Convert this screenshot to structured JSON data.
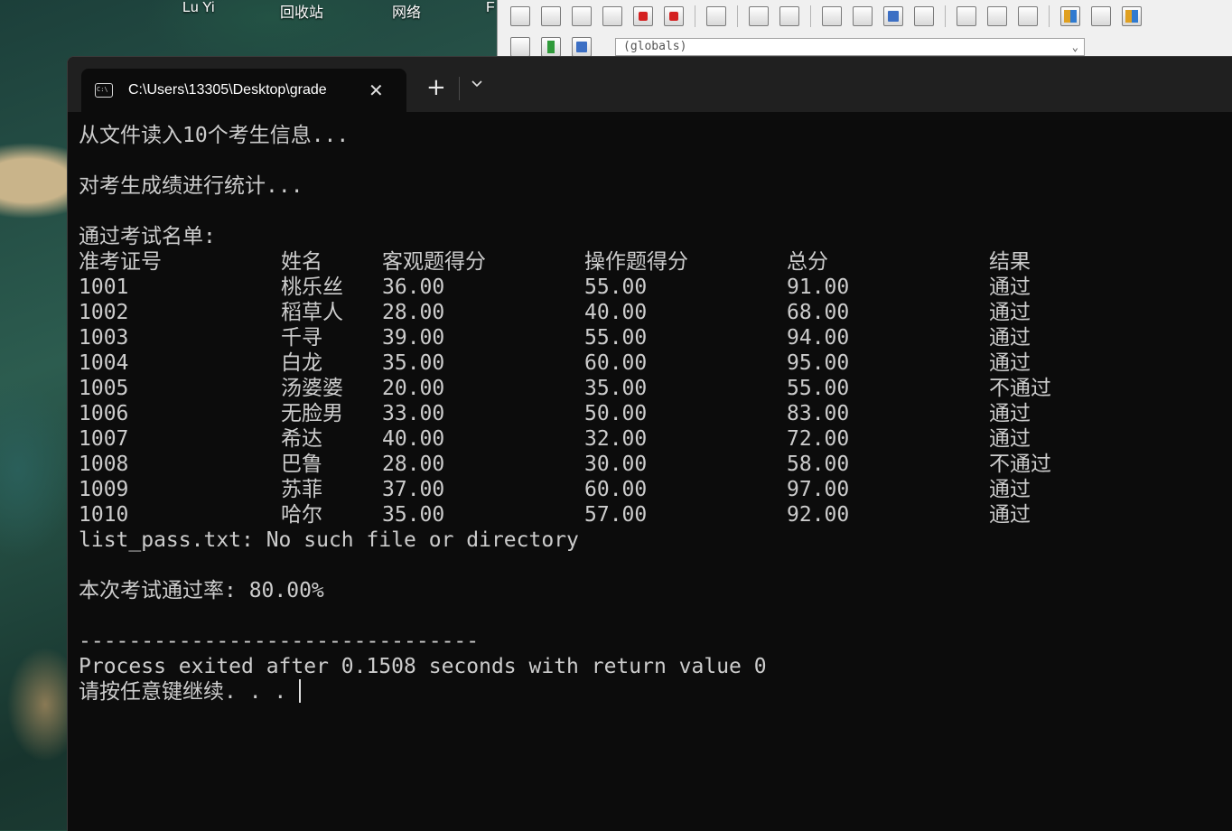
{
  "desktop": {
    "icons": [
      "Lu Yi",
      "回收站",
      "网络",
      "F"
    ]
  },
  "ide": {
    "globals_value": "(globals)"
  },
  "terminal": {
    "tab_title": "C:\\Users\\13305\\Desktop\\grade",
    "tab_close": "✕",
    "new_tab": "+",
    "lines": {
      "read": "从文件读入10个考生信息...",
      "stats": "对考生成绩进行统计...",
      "pass_list": "通过考试名单:",
      "error": "list_pass.txt: No such file or directory",
      "pass_rate": "本次考试通过率: 80.00%",
      "separator": "--------------------------------",
      "process": "Process exited after 0.1508 seconds with return value 0",
      "continue": "请按任意键继续. . ."
    },
    "table": {
      "headers": [
        "准考证号",
        "姓名",
        "客观题得分",
        "操作题得分",
        "总分",
        "结果"
      ],
      "rows": [
        [
          "1001",
          "桃乐丝",
          "36.00",
          "55.00",
          "91.00",
          "通过"
        ],
        [
          "1002",
          "稻草人",
          "28.00",
          "40.00",
          "68.00",
          "通过"
        ],
        [
          "1003",
          "千寻",
          "39.00",
          "55.00",
          "94.00",
          "通过"
        ],
        [
          "1004",
          "白龙",
          "35.00",
          "60.00",
          "95.00",
          "通过"
        ],
        [
          "1005",
          "汤婆婆",
          "20.00",
          "35.00",
          "55.00",
          "不通过"
        ],
        [
          "1006",
          "无脸男",
          "33.00",
          "50.00",
          "83.00",
          "通过"
        ],
        [
          "1007",
          "希达",
          "40.00",
          "32.00",
          "72.00",
          "通过"
        ],
        [
          "1008",
          "巴鲁",
          "28.00",
          "30.00",
          "58.00",
          "不通过"
        ],
        [
          "1009",
          "苏菲",
          "37.00",
          "60.00",
          "97.00",
          "通过"
        ],
        [
          "1010",
          "哈尔",
          "35.00",
          "57.00",
          "92.00",
          "通过"
        ]
      ]
    }
  }
}
